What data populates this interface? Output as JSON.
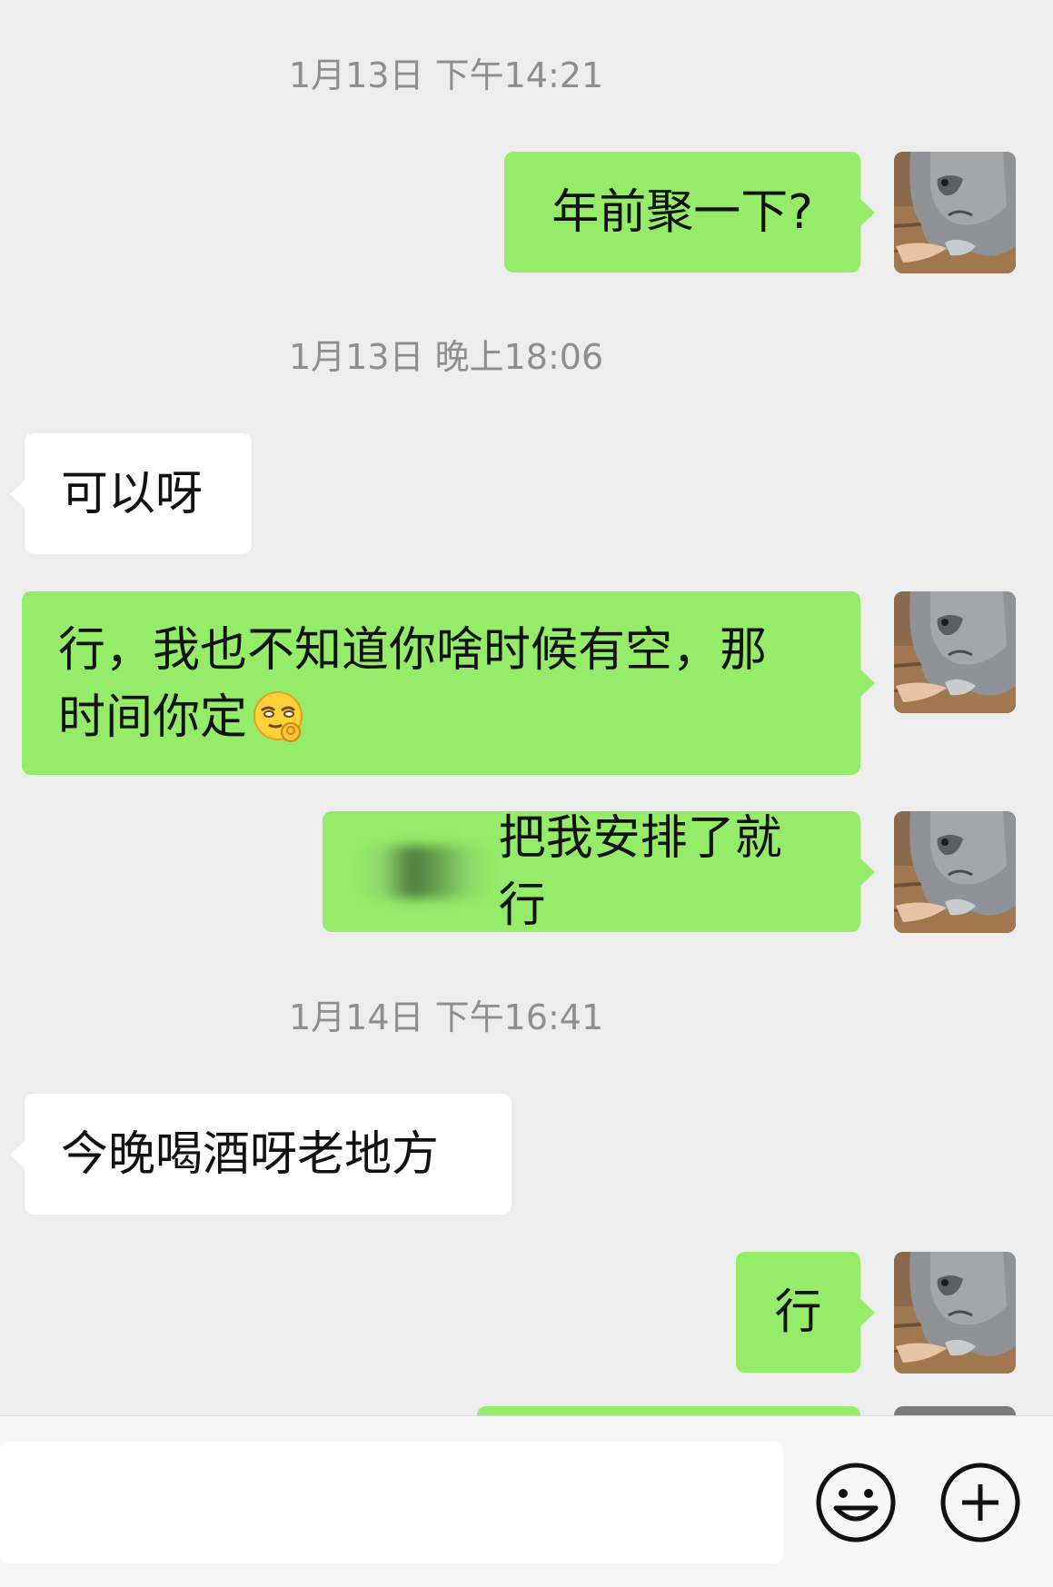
{
  "chat": {
    "timestamps": [
      "1月13日 下午14:21",
      "1月13日 晚上18:06",
      "1月14日 下午16:41"
    ],
    "messages": [
      {
        "sender": "me",
        "text": "年前聚一下?"
      },
      {
        "sender": "other",
        "text": "可以呀"
      },
      {
        "sender": "me",
        "line1": "行，我也不知道你啥时候有空，那",
        "line2": "时间你定",
        "emoji": "thinking-ok-emoji"
      },
      {
        "sender": "me",
        "text": "把我安排了就行",
        "redacted_prefix": true
      },
      {
        "sender": "other",
        "text": "今晚喝酒呀老地方"
      },
      {
        "sender": "me",
        "text": "行"
      }
    ]
  },
  "input_bar": {
    "emoji_icon": "smiley-icon",
    "more_icon": "plus-circle-icon"
  },
  "colors": {
    "background": "#ededed",
    "my_bubble": "#95ec69",
    "other_bubble": "#ffffff",
    "timestamp": "#8e8e8e"
  }
}
